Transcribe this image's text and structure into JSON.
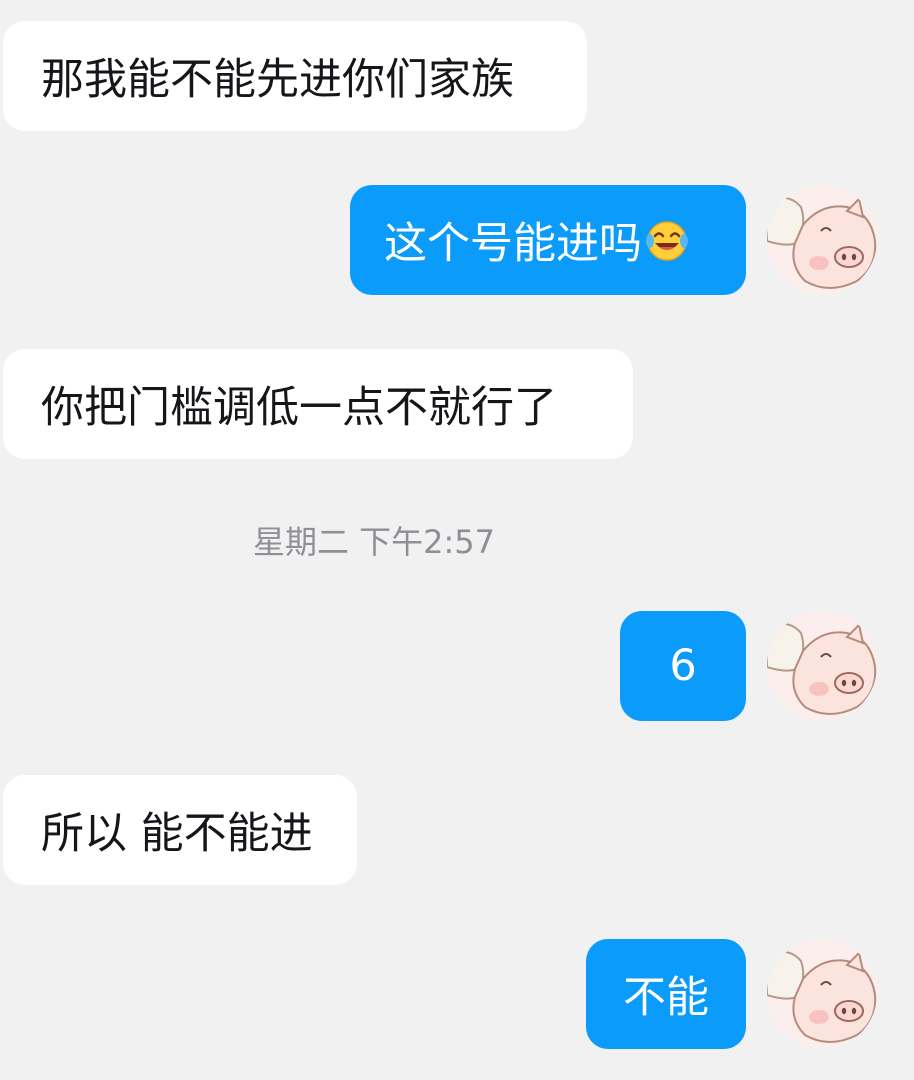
{
  "messages": [
    {
      "direction": "in",
      "text": "那我能不能先进你们家族"
    },
    {
      "direction": "out",
      "text": "这个号能进吗",
      "emoji": "tears-of-joy-emoji"
    },
    {
      "direction": "in",
      "text": "你把门槛调低一点不就行了"
    },
    {
      "direction": "out",
      "text": "6"
    },
    {
      "direction": "in",
      "text": "所以 能不能进"
    },
    {
      "direction": "out",
      "text": "不能"
    }
  ],
  "timestamp": "星期二 下午2:57",
  "avatar": {
    "icon": "pig-avatar-icon"
  },
  "colors": {
    "background": "#f1f1f1",
    "incoming_bubble": "#ffffff",
    "outgoing_bubble": "#0b9bfb",
    "timestamp_text": "#8e9097"
  }
}
